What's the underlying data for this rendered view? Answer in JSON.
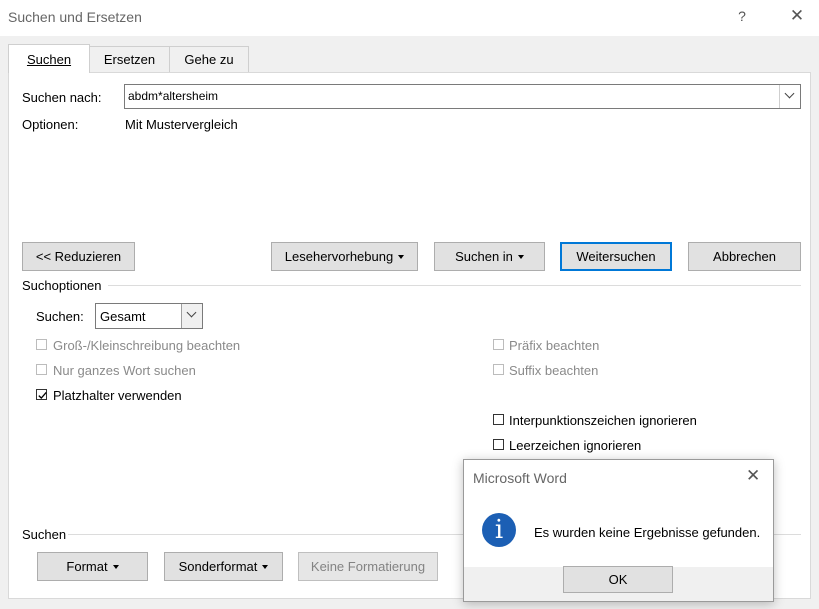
{
  "window": {
    "title": "Suchen und Ersetzen",
    "help": "?",
    "close": "✕"
  },
  "tabs": [
    {
      "label": "Suchen"
    },
    {
      "label": "Ersetzen"
    },
    {
      "label": "Gehe zu"
    }
  ],
  "find": {
    "label": "Suchen nach:",
    "value": "abdm*altersheim",
    "options_label": "Optionen:",
    "options_value": "Mit Mustervergleich"
  },
  "buttons": {
    "reduce": "<< Reduzieren",
    "reading_highlight": "Lesehervorhebung",
    "find_in": "Suchen in",
    "find_next": "Weitersuchen",
    "cancel": "Abbrechen"
  },
  "search_options": {
    "section_title": "Suchoptionen",
    "search_label": "Suchen:",
    "search_value": "Gesamt",
    "left": [
      {
        "label": "Groß-/Kleinschreibung beachten",
        "checked": false,
        "enabled": false
      },
      {
        "label": "Nur ganzes Wort suchen",
        "checked": false,
        "enabled": false
      },
      {
        "label": "Platzhalter verwenden",
        "checked": true,
        "enabled": true
      }
    ],
    "right": [
      {
        "label": "Präfix beachten",
        "checked": false,
        "enabled": false
      },
      {
        "label": "Suffix beachten",
        "checked": false,
        "enabled": false
      },
      {
        "label": "Interpunktionszeichen ignorieren",
        "checked": false,
        "enabled": true
      },
      {
        "label": "Leerzeichen ignorieren",
        "checked": false,
        "enabled": true
      }
    ]
  },
  "bottom": {
    "section_title": "Suchen",
    "format": "Format",
    "special": "Sonderformat",
    "no_formatting": "Keine Formatierung"
  },
  "messagebox": {
    "title": "Microsoft Word",
    "close": "✕",
    "icon": "info-icon",
    "icon_glyph": "i",
    "message": "Es wurden keine Ergebnisse gefunden.",
    "ok": "OK"
  },
  "colors": {
    "accent": "#0078d7",
    "info": "#1c5fb4"
  }
}
